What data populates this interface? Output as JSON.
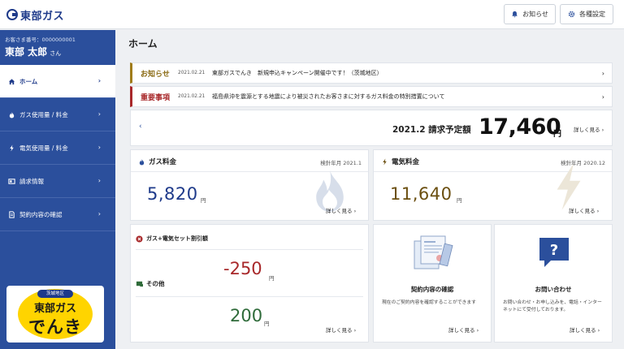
{
  "header": {
    "logo_text": "東部ガス",
    "notice_button": "お知らせ",
    "settings_button": "各種設定"
  },
  "customer": {
    "number_label": "お客さま番号：0000000001",
    "name": "東部 太郎",
    "honorific": "さん"
  },
  "nav": {
    "home": "ホーム",
    "gas": "ガス使用量 / 料金",
    "electric": "電気使用量 / 料金",
    "billing": "請求情報",
    "contract": "契約内容の確認"
  },
  "banner": {
    "tag": "茨城地区",
    "line1": "東部ガス",
    "line2": "でんき"
  },
  "page": {
    "title": "ホーム"
  },
  "notices": [
    {
      "label": "お知らせ",
      "date": "2021.02.21",
      "text": "東部ガスでんき　新規申込キャンペーン開催中です！（茨城地区）"
    },
    {
      "label": "重要事項",
      "date": "2021.02.21",
      "text": "福島県沖を震源とする地震により被災されたお客さまに対するガス料金の特別措置について"
    }
  ],
  "bill": {
    "label": "2021.2 請求予定額",
    "amount": "17,460",
    "unit": "円",
    "link": "詳しく見る ›",
    "prev_arrow": "‹"
  },
  "gas_card": {
    "title": "ガス料金",
    "month": "検針年月 2021.1",
    "amount": "5,820",
    "unit": "円",
    "link": "詳しく見る ›"
  },
  "electric_card": {
    "title": "電気料金",
    "month": "検針年月 2020.12",
    "amount": "11,640",
    "unit": "円",
    "link": "詳しく見る ›"
  },
  "set_card": {
    "title": "ガス+電気セット割引額",
    "discount": "-250",
    "discount_unit": "円",
    "other_label": "その他",
    "other": "200",
    "other_unit": "円",
    "link": "詳しく見る ›"
  },
  "contract_tile": {
    "title": "契約内容の確認",
    "desc": "現在のご契約内容を確認することができます",
    "link": "詳しく見る ›"
  },
  "inquiry_tile": {
    "title": "お問い合わせ",
    "desc": "お問い合わせ・お申し込みを、電話・インターネットにて受付しております。",
    "link": "詳しく見る ›"
  },
  "colors": {
    "primary": "#2b4f9c",
    "notice_accent": "#a07c1a",
    "important_accent": "#a8282a",
    "gas_amount": "#1e3a8a",
    "electric_amount": "#6b4f10",
    "discount": "#a8282a",
    "other": "#2f6b3a"
  },
  "icons": [
    "bell-icon",
    "gear-icon",
    "home-icon",
    "flame-icon",
    "bolt-icon",
    "bill-icon",
    "document-icon",
    "close-circle-icon",
    "tag-icon",
    "question-icon"
  ]
}
